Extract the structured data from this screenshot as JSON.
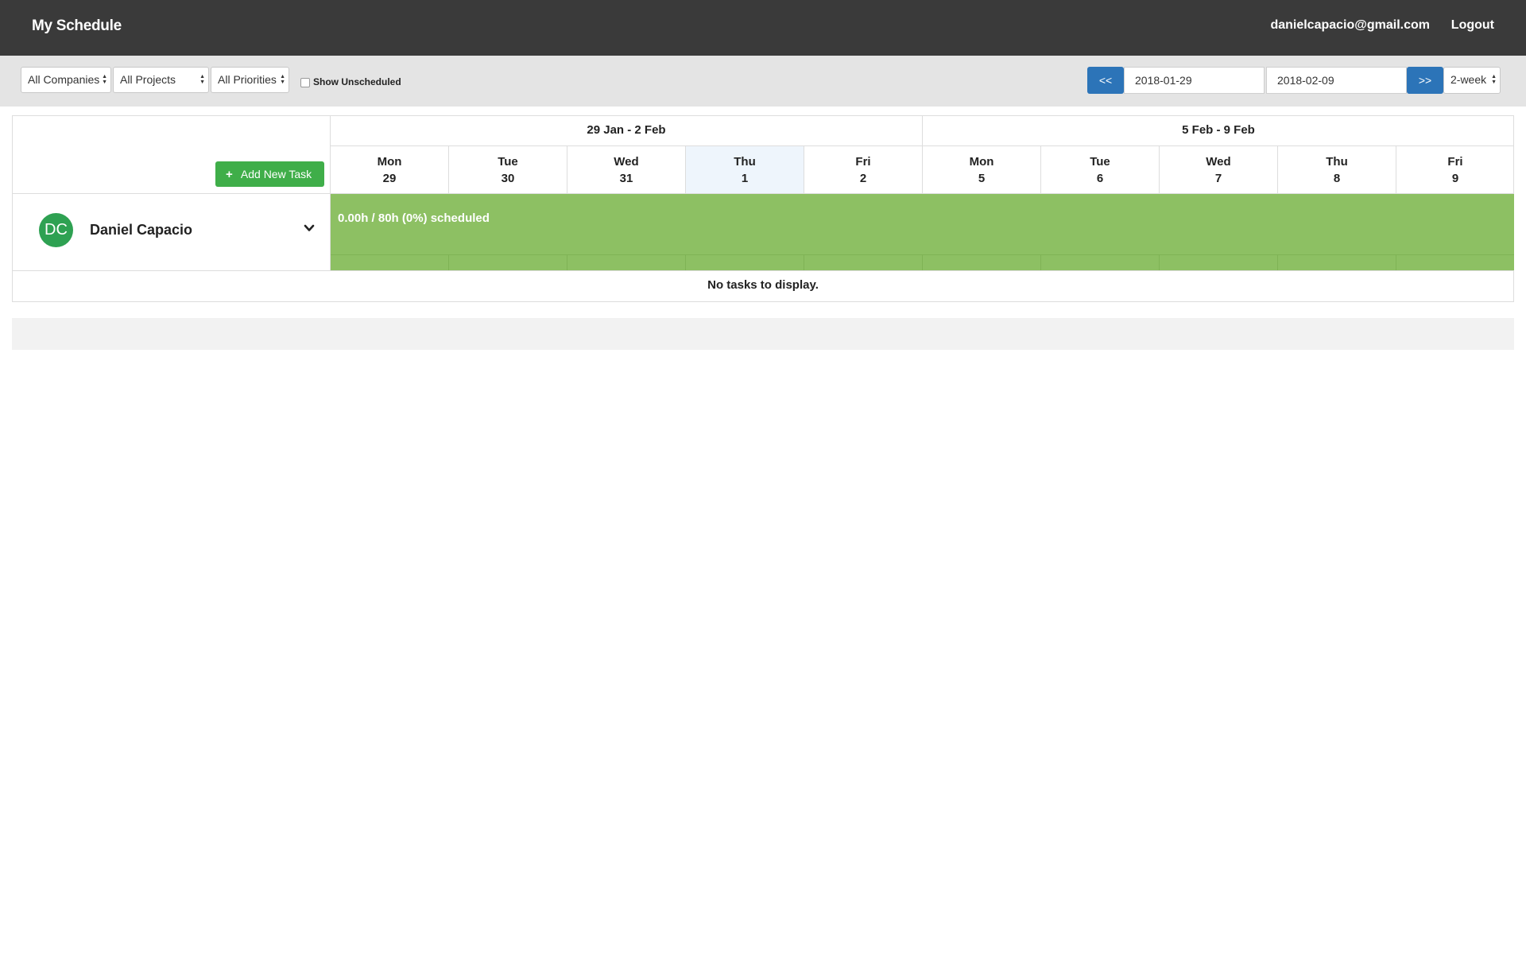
{
  "header": {
    "title": "My Schedule",
    "user_email": "danielcapacio@gmail.com",
    "logout_label": "Logout"
  },
  "filters": {
    "company": "All Companies",
    "project": "All Projects",
    "priority": "All Priorities",
    "show_unscheduled_label": "Show Unscheduled",
    "show_unscheduled_checked": false
  },
  "date_range": {
    "prev_label": "<<",
    "next_label": ">>",
    "start": "2018-01-29",
    "end": "2018-02-09",
    "view": "2-week"
  },
  "schedule": {
    "add_task_label": "Add New Task",
    "weeks": [
      {
        "label": "29 Jan - 2 Feb"
      },
      {
        "label": "5 Feb - 9 Feb"
      }
    ],
    "days": [
      {
        "name": "Mon",
        "num": "29"
      },
      {
        "name": "Tue",
        "num": "30"
      },
      {
        "name": "Wed",
        "num": "31"
      },
      {
        "name": "Thu",
        "num": "1"
      },
      {
        "name": "Fri",
        "num": "2"
      },
      {
        "name": "Mon",
        "num": "5"
      },
      {
        "name": "Tue",
        "num": "6"
      },
      {
        "name": "Wed",
        "num": "7"
      },
      {
        "name": "Thu",
        "num": "8"
      },
      {
        "name": "Fri",
        "num": "9"
      }
    ],
    "today_index": 3,
    "person": {
      "initials": "DC",
      "name": "Daniel Capacio",
      "summary": "0.00h / 80h (0%) scheduled"
    },
    "empty_message": "No tasks to display."
  },
  "colors": {
    "navbar": "#3a3a3a",
    "primary_button": "#2c74b8",
    "success_button": "#3fae49",
    "load_bar": "#8dc063",
    "avatar": "#2ea152",
    "today_highlight": "#eef5fc"
  }
}
